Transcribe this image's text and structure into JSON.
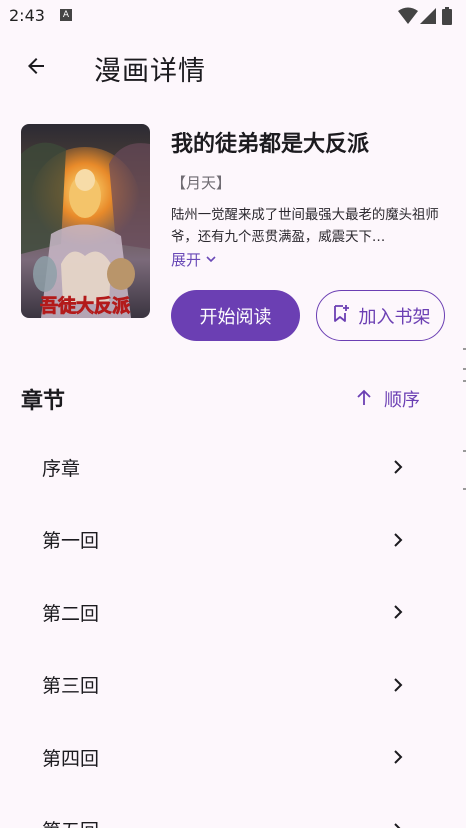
{
  "status_bar": {
    "time": "2:43",
    "notification_icon": "a-box-icon",
    "wifi_icon": "wifi-icon",
    "signal_icon": "signal-icon",
    "battery_icon": "battery-icon"
  },
  "app_bar": {
    "back_icon": "arrow-left-icon",
    "title": "漫画详情"
  },
  "book": {
    "title": "我的徒弟都是大反派",
    "author": "【月天】",
    "description": "陆州一觉醒来成了世间最强大最老的魔头祖师爷，还有九个恶贯满盈，威震天下…",
    "expand_label": "展开",
    "cover_text": "吾徒大反派"
  },
  "actions": {
    "start_reading": "开始阅读",
    "add_to_shelf": "加入书架"
  },
  "chapters": {
    "section_title": "章节",
    "sort_label": "顺序",
    "items": [
      {
        "label": "序章"
      },
      {
        "label": "第一回"
      },
      {
        "label": "第二回"
      },
      {
        "label": "第三回"
      },
      {
        "label": "第四回"
      },
      {
        "label": "第五回"
      }
    ]
  },
  "colors": {
    "accent": "#6b3fb3",
    "background": "#fdf7fc",
    "text_primary": "#1c1b1f",
    "text_secondary": "#6f6b72"
  }
}
